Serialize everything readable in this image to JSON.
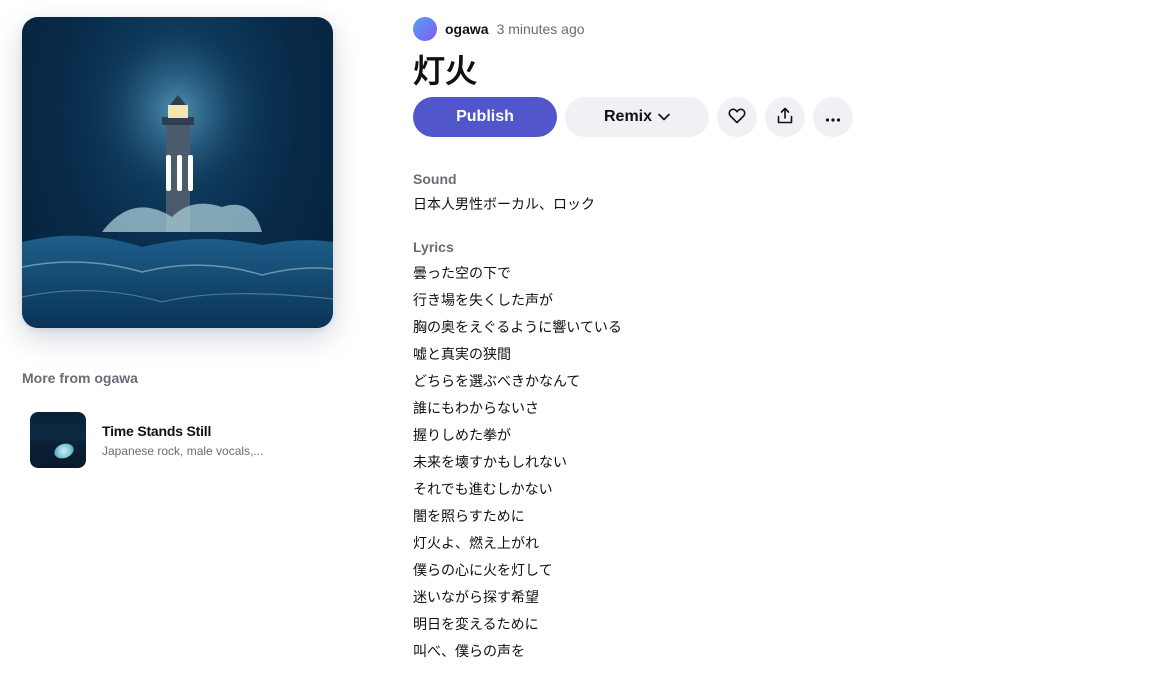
{
  "song": {
    "author": "ogawa",
    "time_ago": "3 minutes ago",
    "title": "灯火",
    "cover_icon": "playing-bars-icon"
  },
  "actions": {
    "publish_label": "Publish",
    "remix_label": "Remix",
    "remix_icon": "chevron-down-icon",
    "like_icon": "heart-icon",
    "share_icon": "share-upload-icon",
    "more_icon": "ellipsis-icon"
  },
  "sound": {
    "label": "Sound",
    "value": "日本人男性ボーカル、ロック"
  },
  "lyrics": {
    "label": "Lyrics",
    "lines": [
      "曇った空の下で",
      "行き場を失くした声が",
      "胸の奥をえぐるように響いている",
      "嘘と真実の狭間",
      "どちらを選ぶべきかなんて",
      "誰にもわからないさ",
      "握りしめた拳が",
      "未来を壊すかもしれない",
      "それでも進むしかない",
      "闇を照らすために",
      "灯火よ、燃え上がれ",
      "僕らの心に火を灯して",
      "迷いながら探す希望",
      "明日を変えるために",
      "叫べ、僕らの声を"
    ]
  },
  "more_from": {
    "heading": "More from ogawa",
    "items": [
      {
        "title": "Time Stands Still",
        "subtitle": "Japanese rock, male vocals,..."
      }
    ]
  },
  "colors": {
    "publish": "#5156cb",
    "secondary_button": "#f0f0f5",
    "muted_text": "#6b6b78"
  }
}
